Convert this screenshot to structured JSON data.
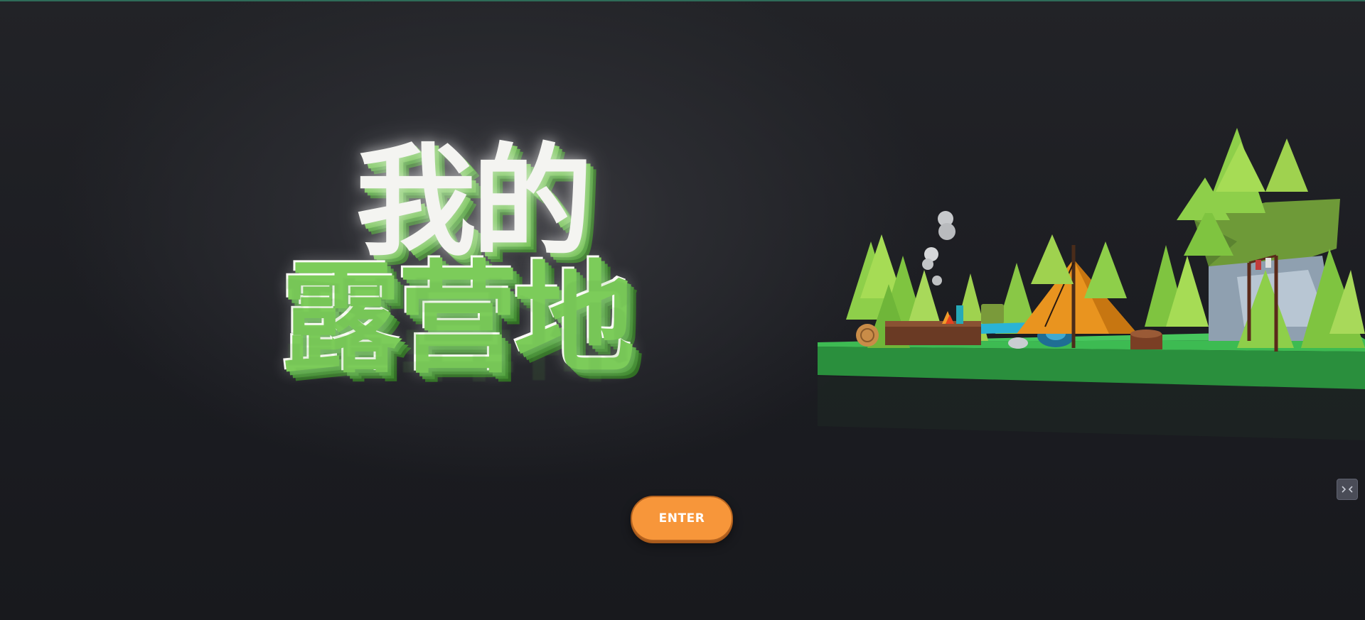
{
  "title": {
    "line1": "我的",
    "line2": "露营地"
  },
  "enter_button": {
    "label": "ENTER"
  },
  "corner_widget": {
    "icon": "collapse-arrows-icon"
  },
  "colors": {
    "background": "#1b1c20",
    "accent_orange": "#f7963a",
    "grass_green": "#2fa446",
    "tent_orange": "#e9941f"
  }
}
